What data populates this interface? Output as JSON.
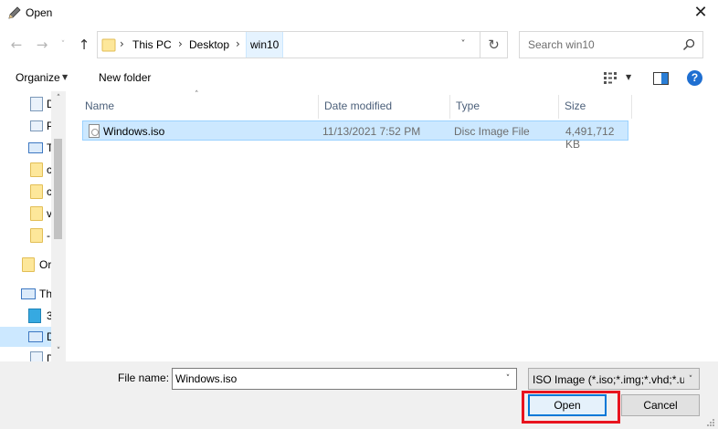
{
  "window": {
    "title": "Open",
    "close_glyph": "✕"
  },
  "nav": {
    "back_glyph": "←",
    "forward_glyph": "→",
    "recent_glyph": "˅",
    "up_glyph": "↑"
  },
  "address": {
    "breadcrumbs": [
      "This PC",
      "Desktop",
      "win10"
    ],
    "separator": "›",
    "dropdown_glyph": "˅",
    "refresh_glyph": "↻"
  },
  "search": {
    "placeholder": "Search win10"
  },
  "toolbar": {
    "organize_label": "Organize",
    "caret": "▼",
    "new_folder_label": "New folder",
    "help_glyph": "?"
  },
  "navpane": {
    "items": [
      {
        "icon": "document-icon",
        "label": "D"
      },
      {
        "icon": "picture-icon",
        "label": "P"
      },
      {
        "icon": "monitor-icon",
        "label": "T"
      },
      {
        "icon": "folder-icon",
        "label": "c"
      },
      {
        "icon": "folder-icon",
        "label": "c"
      },
      {
        "icon": "folder-icon",
        "label": "v"
      },
      {
        "icon": "folder-icon",
        "label": "-"
      },
      {
        "icon": "folder-icon",
        "label": "Or"
      },
      {
        "icon": "monitor-icon",
        "label": "Th"
      },
      {
        "icon": "3d-objects-icon",
        "label": "3"
      },
      {
        "icon": "desktop-icon",
        "label": "D"
      },
      {
        "icon": "document-icon",
        "label": "D"
      }
    ],
    "scroll_up": "˄",
    "scroll_down": "˅"
  },
  "filelist": {
    "sort_indicator": "˄",
    "columns": [
      "Name",
      "Date modified",
      "Type",
      "Size"
    ],
    "rows": [
      {
        "name": "Windows.iso",
        "date_modified": "11/13/2021 7:52 PM",
        "type": "Disc Image File",
        "size": "4,491,712 KB"
      }
    ]
  },
  "footer": {
    "file_name_label": "File name:",
    "file_name_value": "Windows.iso",
    "file_type_value": "ISO Image (*.iso;*.img;*.vhd;*.u",
    "open_label": "Open",
    "cancel_label": "Cancel",
    "caret": "˅"
  },
  "colors": {
    "selection": "#cce8ff",
    "accent": "#0078d7",
    "highlight_box": "#e8141e"
  }
}
